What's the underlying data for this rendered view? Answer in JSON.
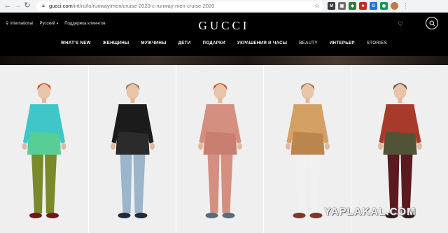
{
  "browser": {
    "url_host": "gucci.com",
    "url_path": "/int/ru/lo/runway/men/cruise-2020-c-runway-men-cruise-2020",
    "extensions": [
      {
        "name": "M",
        "color": "#3a3a3a"
      },
      {
        "name": "▣",
        "color": "#6f6f6f"
      },
      {
        "name": "◆",
        "color": "#2e7d32"
      },
      {
        "name": "■",
        "color": "#c62828"
      },
      {
        "name": "G",
        "color": "#1a73e8"
      },
      {
        "name": "◉",
        "color": "#0f9d58"
      }
    ]
  },
  "header": {
    "logo": "GUCCI",
    "region": "International",
    "language": "Русский",
    "support": "Поддержка клиентов",
    "nav": [
      {
        "label": "WHAT'S NEW",
        "bold": true
      },
      {
        "label": "ЖЕНЩИНЫ",
        "bold": true
      },
      {
        "label": "МУЖЧИНЫ",
        "bold": true
      },
      {
        "label": "ДЕТИ",
        "bold": true
      },
      {
        "label": "ПОДАРКИ",
        "bold": true
      },
      {
        "label": "УКРАШЕНИЯ И ЧАСЫ",
        "bold": true
      },
      {
        "label": "BEAUTY",
        "bold": false
      },
      {
        "label": "ИНТЕРЬЕР",
        "bold": true
      },
      {
        "label": "STORIES",
        "bold": false
      }
    ],
    "colors": {
      "background": "#000000",
      "text": "#ffffff"
    }
  },
  "looks": [
    {
      "id": "look-1",
      "shirt": "#3ec6c9",
      "shirt_accent": "#5fd08a",
      "pants": "#7a8a2a",
      "shoes": "#6b1a1a",
      "hair": "#c9501c"
    },
    {
      "id": "look-2",
      "shirt": "#1b1b1b",
      "shirt_accent": "#2f2f2f",
      "pants": "#9ab5cc",
      "shoes": "#1f2a3a",
      "hair": "#8a7a6a"
    },
    {
      "id": "look-3",
      "shirt": "#d48f80",
      "shirt_accent": "#c47a6c",
      "pants": "#d48f80",
      "shoes": "#5a6a7a",
      "hair": "#c9501c"
    },
    {
      "id": "look-4",
      "shirt": "#d4a064",
      "shirt_accent": "#b47f48",
      "pants": "#f1f1f1",
      "shoes": "#7a3a2a",
      "hair": "#b0704a"
    },
    {
      "id": "look-5",
      "shirt": "#a83a2a",
      "shirt_accent": "#3a5a3a",
      "pants": "#5a1a1f",
      "shoes": "#2a1a1a",
      "hair": "#6b4a3a"
    }
  ],
  "watermark": "YAPLAKAL.COM"
}
